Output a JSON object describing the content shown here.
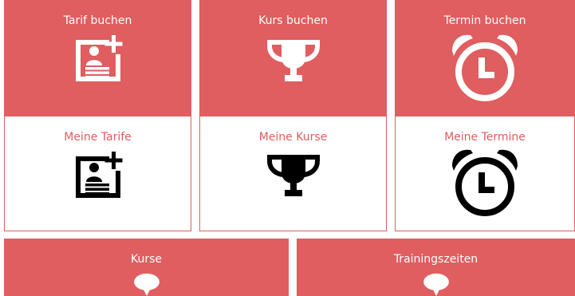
{
  "tiles_top": [
    {
      "label": "Tarif buchen",
      "icon": "id-card-plus-icon"
    },
    {
      "label": "Kurs buchen",
      "icon": "trophy-icon"
    },
    {
      "label": "Termin buchen",
      "icon": "alarm-clock-icon"
    }
  ],
  "tiles_mid": [
    {
      "label": "Meine Tarife",
      "icon": "id-card-plus-icon"
    },
    {
      "label": "Meine Kurse",
      "icon": "trophy-icon"
    },
    {
      "label": "Meine Termine",
      "icon": "alarm-clock-icon"
    }
  ],
  "tiles_bottom": [
    {
      "label": "Kurse",
      "icon": "speech-bubble-icon"
    },
    {
      "label": "Trainingszeiten",
      "icon": "speech-bubble-icon"
    }
  ],
  "colors": {
    "accent": "#e05d60",
    "icon_on_white": "#000000",
    "icon_on_red": "#ffffff"
  }
}
